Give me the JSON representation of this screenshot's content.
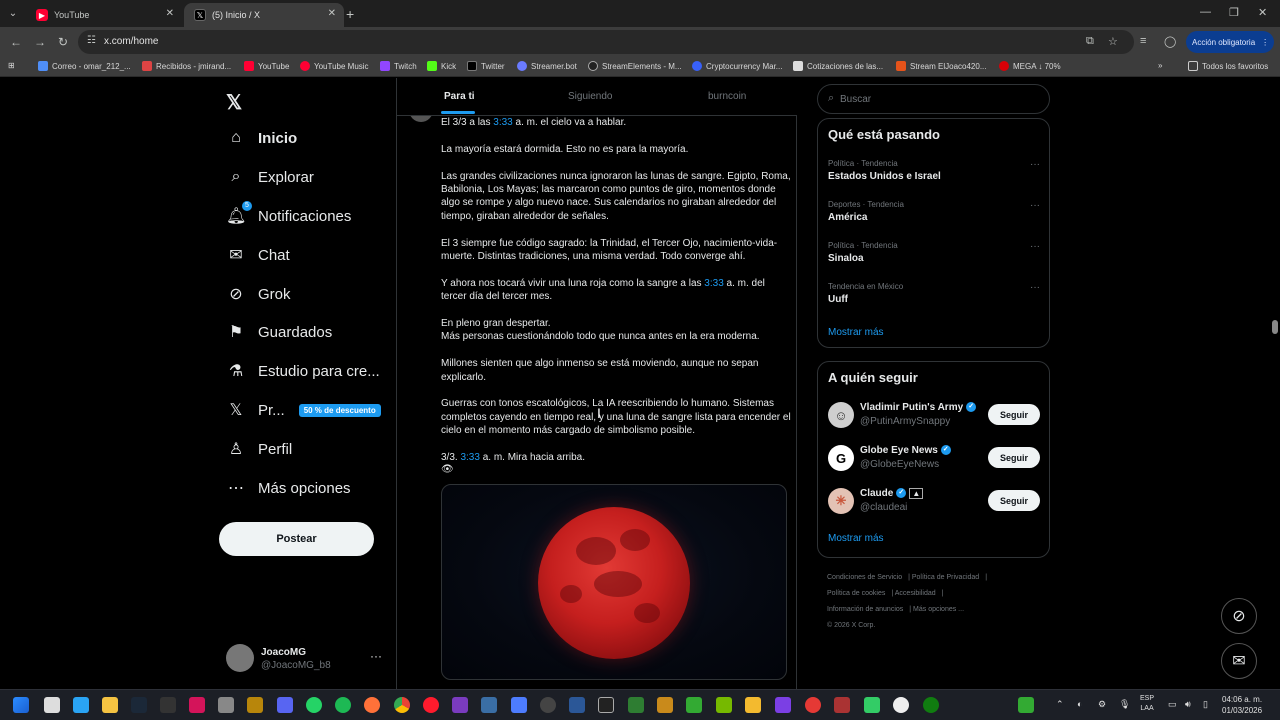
{
  "browser": {
    "tabs": [
      {
        "title": "YouTube",
        "active": false
      },
      {
        "title": "(5) Inicio / X",
        "active": true
      }
    ],
    "url": "x.com/home",
    "action_button": "Acción obligatoria",
    "bookmarks": [
      "Correo - omar_212_...",
      "Recibidos - jmirand...",
      "YouTube",
      "YouTube Music",
      "Twitch",
      "Kick",
      "Twitter",
      "Streamer.bot",
      "StreamElements - M...",
      "Cryptocurrency Mar...",
      "Cotizaciones de las...",
      "Stream ElJoaco420...",
      "MEGA ↓ 70%",
      "Todos los favoritos"
    ]
  },
  "nav": {
    "items": [
      {
        "label": "Inicio",
        "icon": "home-icon"
      },
      {
        "label": "Explorar",
        "icon": "search-icon"
      },
      {
        "label": "Notificaciones",
        "icon": "bell-icon",
        "badge": "5"
      },
      {
        "label": "Chat",
        "icon": "mail-icon"
      },
      {
        "label": "Grok",
        "icon": "grok-icon"
      },
      {
        "label": "Guardados",
        "icon": "bookmark-icon"
      },
      {
        "label": "Estudio para cre...",
        "icon": "flask-icon"
      },
      {
        "label": "Pr...",
        "icon": "x-icon",
        "promo": "50 % de descuento"
      },
      {
        "label": "Perfil",
        "icon": "person-icon"
      },
      {
        "label": "Más opciones",
        "icon": "more-circle-icon"
      }
    ],
    "post_button": "Postear",
    "profile": {
      "name": "JoacoMG",
      "handle": "@JoacoMG_b8"
    }
  },
  "feed": {
    "tabs": [
      "Para ti",
      "Siguiendo",
      "burncoin"
    ],
    "post": {
      "line1_pre": "El 3/3 a las ",
      "line1_link": "3:33",
      "line1_post": " a. m. el cielo va a hablar.",
      "p2": "La mayoría estará dormida. Esto no es para la mayoría.",
      "p3": "Las grandes civilizaciones nunca ignoraron las lunas de sangre. Egipto, Roma, Babilonia, Los Mayas; las marcaron como puntos de giro, momentos donde algo se rompe y algo nuevo nace. Sus calendarios no giraban alrededor del tiempo, giraban alrededor de señales.",
      "p4": "El 3 siempre fue código sagrado: la Trinidad, el Tercer Ojo, nacimiento-vida-muerte. Distintas tradiciones, una misma verdad. Todo converge ahí.",
      "p5_pre": "Y ahora nos tocará vivir una luna roja como la sangre a las ",
      "p5_link": "3:33",
      "p5_post": " a. m. del tercer día del tercer mes.",
      "p6a": "En pleno gran despertar.",
      "p6b": "Más personas cuestionándolo todo que nunca antes en la era moderna.",
      "p7": "Millones sienten que algo inmenso se está moviendo, aunque no sepan explicarlo.",
      "p8": "Guerras con tonos escatológicos, La IA reescribiendo lo humano. Sistemas completos cayendo en tiempo real, y una luna de sangre lista para encender el cielo en el momento más cargado de simbolismo posible.",
      "p9_pre": "3/3. ",
      "p9_link": "3:33",
      "p9_post": " a. m. Mira hacia arriba.",
      "eye": "👁"
    }
  },
  "right": {
    "search_placeholder": "Buscar",
    "trends_title": "Qué está pasando",
    "trends": [
      {
        "meta": "Política · Tendencia",
        "name": "Estados Unidos e Israel"
      },
      {
        "meta": "Deportes · Tendencia",
        "name": "América"
      },
      {
        "meta": "Política · Tendencia",
        "name": "Sinaloa"
      },
      {
        "meta": "Tendencia en México",
        "name": "Uuff"
      }
    ],
    "show_more": "Mostrar más",
    "follow_title": "A quién seguir",
    "follows": [
      {
        "name": "Vladimir Putin's Army",
        "handle": "@PutinArmySnappy",
        "button": "Seguir"
      },
      {
        "name": "Globe Eye News",
        "handle": "@GlobeEyeNews",
        "button": "Seguir"
      },
      {
        "name": "Claude",
        "handle": "@claudeai",
        "button": "Seguir"
      }
    ],
    "footer": [
      "Condiciones de Servicio",
      "Política de Privacidad",
      "Política de cookies",
      "Accesibilidad",
      "Información de anuncios",
      "Más opciones ...",
      "© 2026 X Corp."
    ]
  },
  "taskbar": {
    "lang": "ESP",
    "lang2": "LAA",
    "time": "04:06 a. m.",
    "date": "01/03/2026"
  },
  "colors": {
    "accent": "#1d9bf0",
    "background": "#000000",
    "border": "#2f3336",
    "muted": "#71767b"
  }
}
